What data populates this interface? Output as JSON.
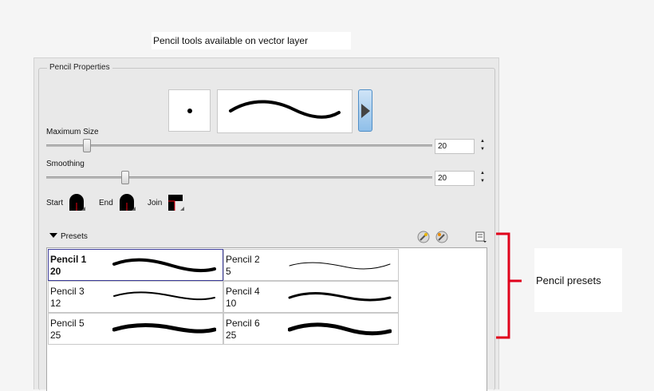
{
  "top_caption": "Pencil tools available on vector layer",
  "right_caption": "Pencil presets",
  "panel": {
    "title": "Pencil Properties",
    "maximum_size": {
      "label": "Maximum Size",
      "value": "20"
    },
    "smoothing": {
      "label": "Smoothing",
      "value": "20"
    },
    "start_label": "Start",
    "end_label": "End",
    "join_label": "Join",
    "presets_label": "Presets",
    "presets": [
      {
        "name": "Pencil 1",
        "size": "20"
      },
      {
        "name": "Pencil 2",
        "size": "5"
      },
      {
        "name": "Pencil 3",
        "size": "12"
      },
      {
        "name": "Pencil 4",
        "size": "10"
      },
      {
        "name": "Pencil 5",
        "size": "25"
      },
      {
        "name": "Pencil 6",
        "size": "25"
      }
    ]
  },
  "colors": {
    "accent_button": "#8fbfe9",
    "selection_border": "#3c3c9a",
    "annotation_bracket": "#e0001b"
  },
  "icons": [
    "play-icon",
    "cap-round-icon",
    "cap-flat-icon",
    "join-miter-icon",
    "new-preset-icon",
    "delete-preset-icon",
    "preset-menu-icon"
  ]
}
